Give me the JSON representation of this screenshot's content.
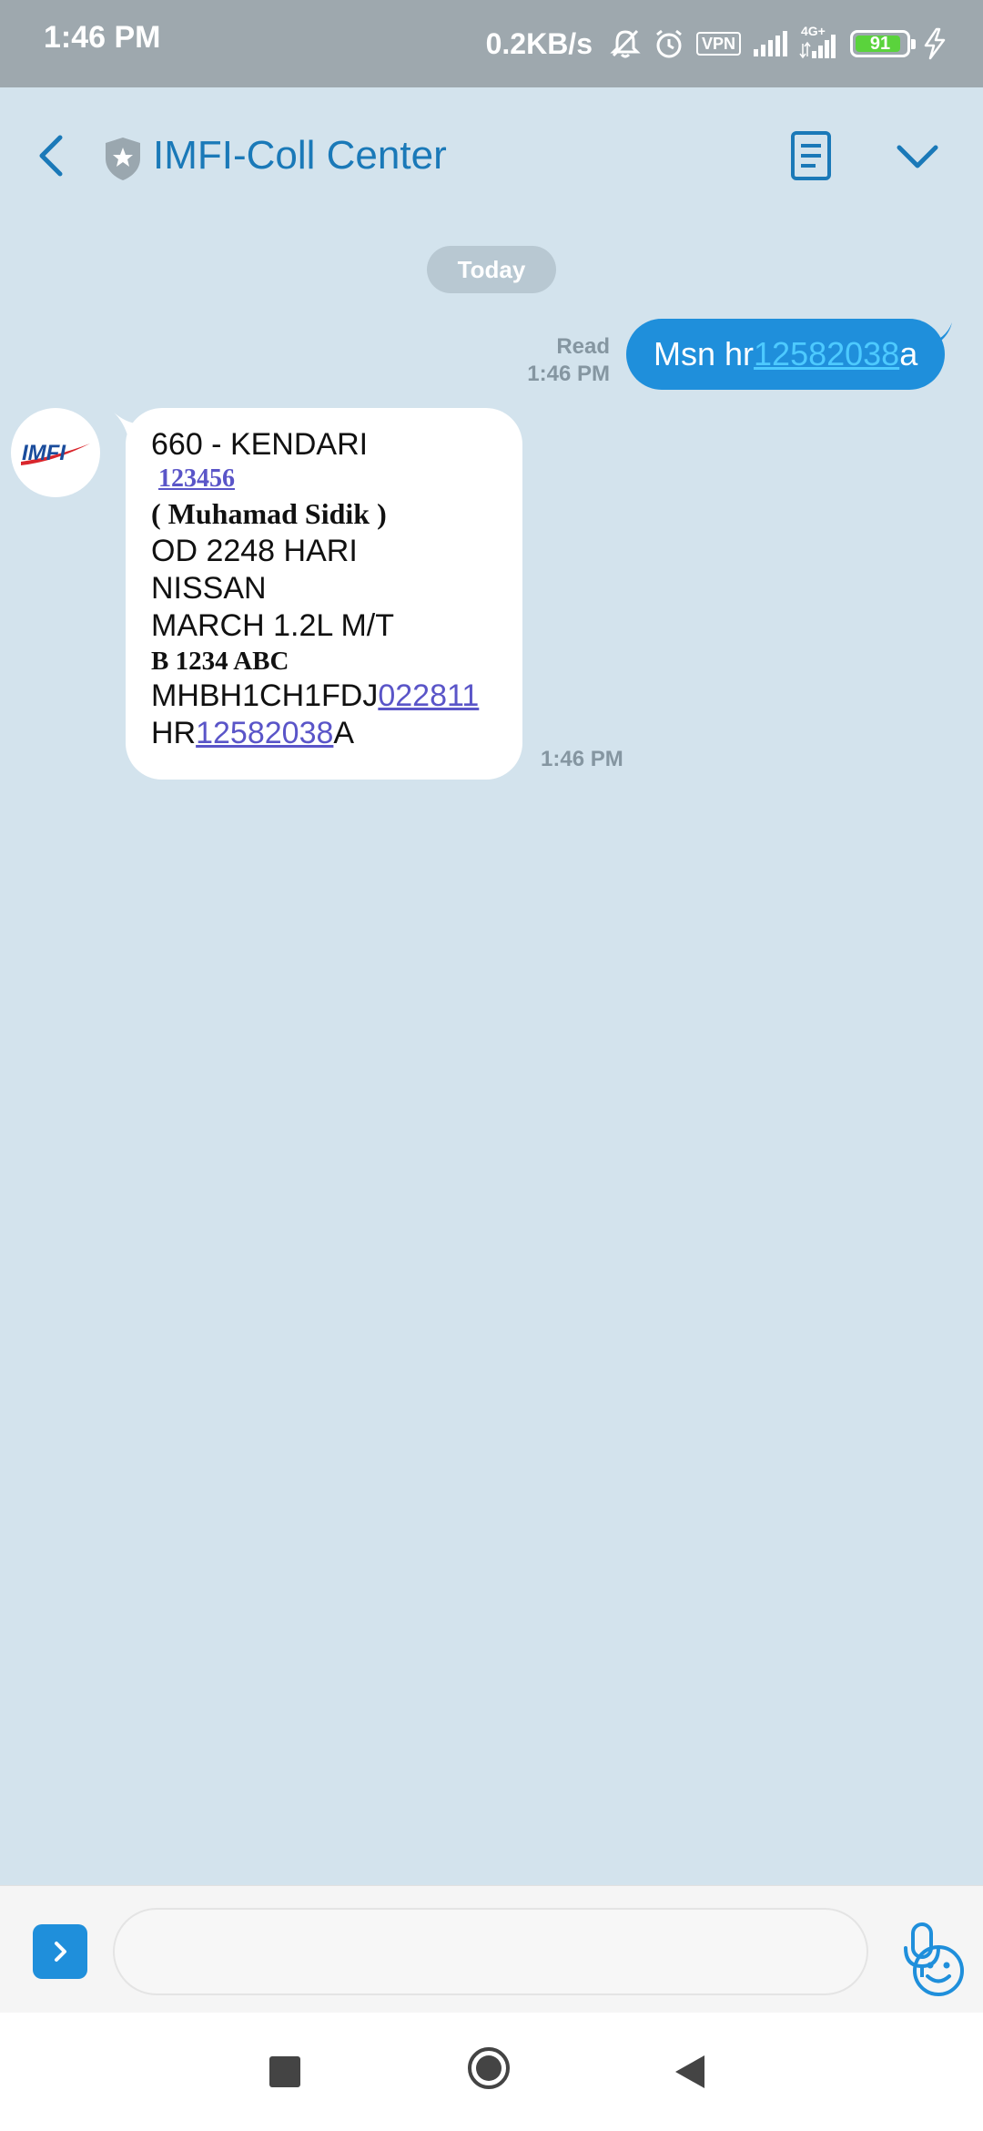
{
  "status_bar": {
    "time": "1:46 PM",
    "net_speed": "0.2KB/s",
    "vpn": "VPN",
    "network": "4G+",
    "battery_level": "91",
    "icons": [
      "mute-icon",
      "alarm-icon",
      "vpn-icon",
      "signal-icon",
      "signal-4g-icon",
      "battery-icon",
      "charging-icon"
    ]
  },
  "header": {
    "title": "IMFI-Coll Center",
    "icons": [
      "back-arrow-icon",
      "verified-shield-icon",
      "details-icon",
      "chevron-down-icon"
    ]
  },
  "conversation": {
    "date_chip": "Today",
    "sent": {
      "status": "Read",
      "time": "1:46 PM",
      "text_before": "Msn hr",
      "link": "12582038",
      "text_after": "a"
    },
    "received": {
      "sender_avatar": "IMFI",
      "time": "1:46 PM",
      "lines": {
        "branch": "660 - KENDARI",
        "account_number": "123456",
        "name": "( Muhamad Sidik )",
        "overdue": "OD 2248 HARI",
        "brand": "NISSAN",
        "model": "MARCH 1.2L M/T",
        "plate": "B 1234 ABC",
        "chassis_prefix": "MHBH1CH1FDJ",
        "chassis_link": "022811",
        "engine_prefix": "HR",
        "engine_link": "12582038",
        "engine_suffix": "A"
      }
    }
  },
  "composer": {
    "placeholder": "",
    "icons": [
      "expand-icon",
      "emoji-icon",
      "microphone-icon"
    ]
  },
  "nav_bar": {
    "icons": [
      "recents-icon",
      "home-icon",
      "back-icon"
    ]
  },
  "colors": {
    "background": "#d3e3ed",
    "accent": "#1a79b8",
    "sent_bubble": "#1f8fdb",
    "link": "#5a55c8",
    "battery": "#5ad33c"
  }
}
